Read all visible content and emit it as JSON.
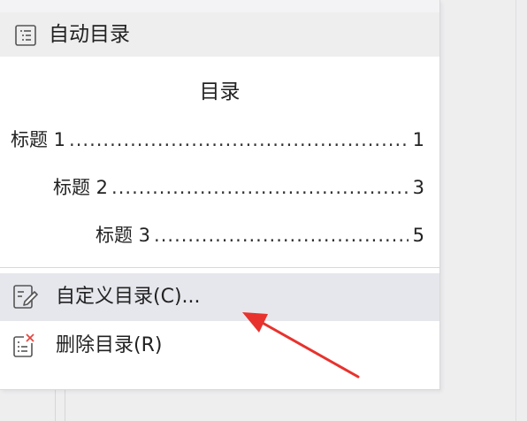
{
  "section": {
    "icon": "toc-list-icon",
    "label": "自动目录"
  },
  "preview": {
    "title": "目录",
    "entries": [
      {
        "text": "标题 1",
        "page": "1"
      },
      {
        "text": "标题 2",
        "page": "3"
      },
      {
        "text": "标题 3",
        "page": "5"
      }
    ],
    "dots": "........................................................................................................"
  },
  "menu": {
    "items": [
      {
        "label": "自定义目录(C)...",
        "icon": "edit-document-icon",
        "highlighted": true
      },
      {
        "label": "删除目录(R)",
        "icon": "delete-toc-icon",
        "highlighted": false
      }
    ]
  },
  "annotation": {
    "arrow_color": "#e8322d"
  }
}
